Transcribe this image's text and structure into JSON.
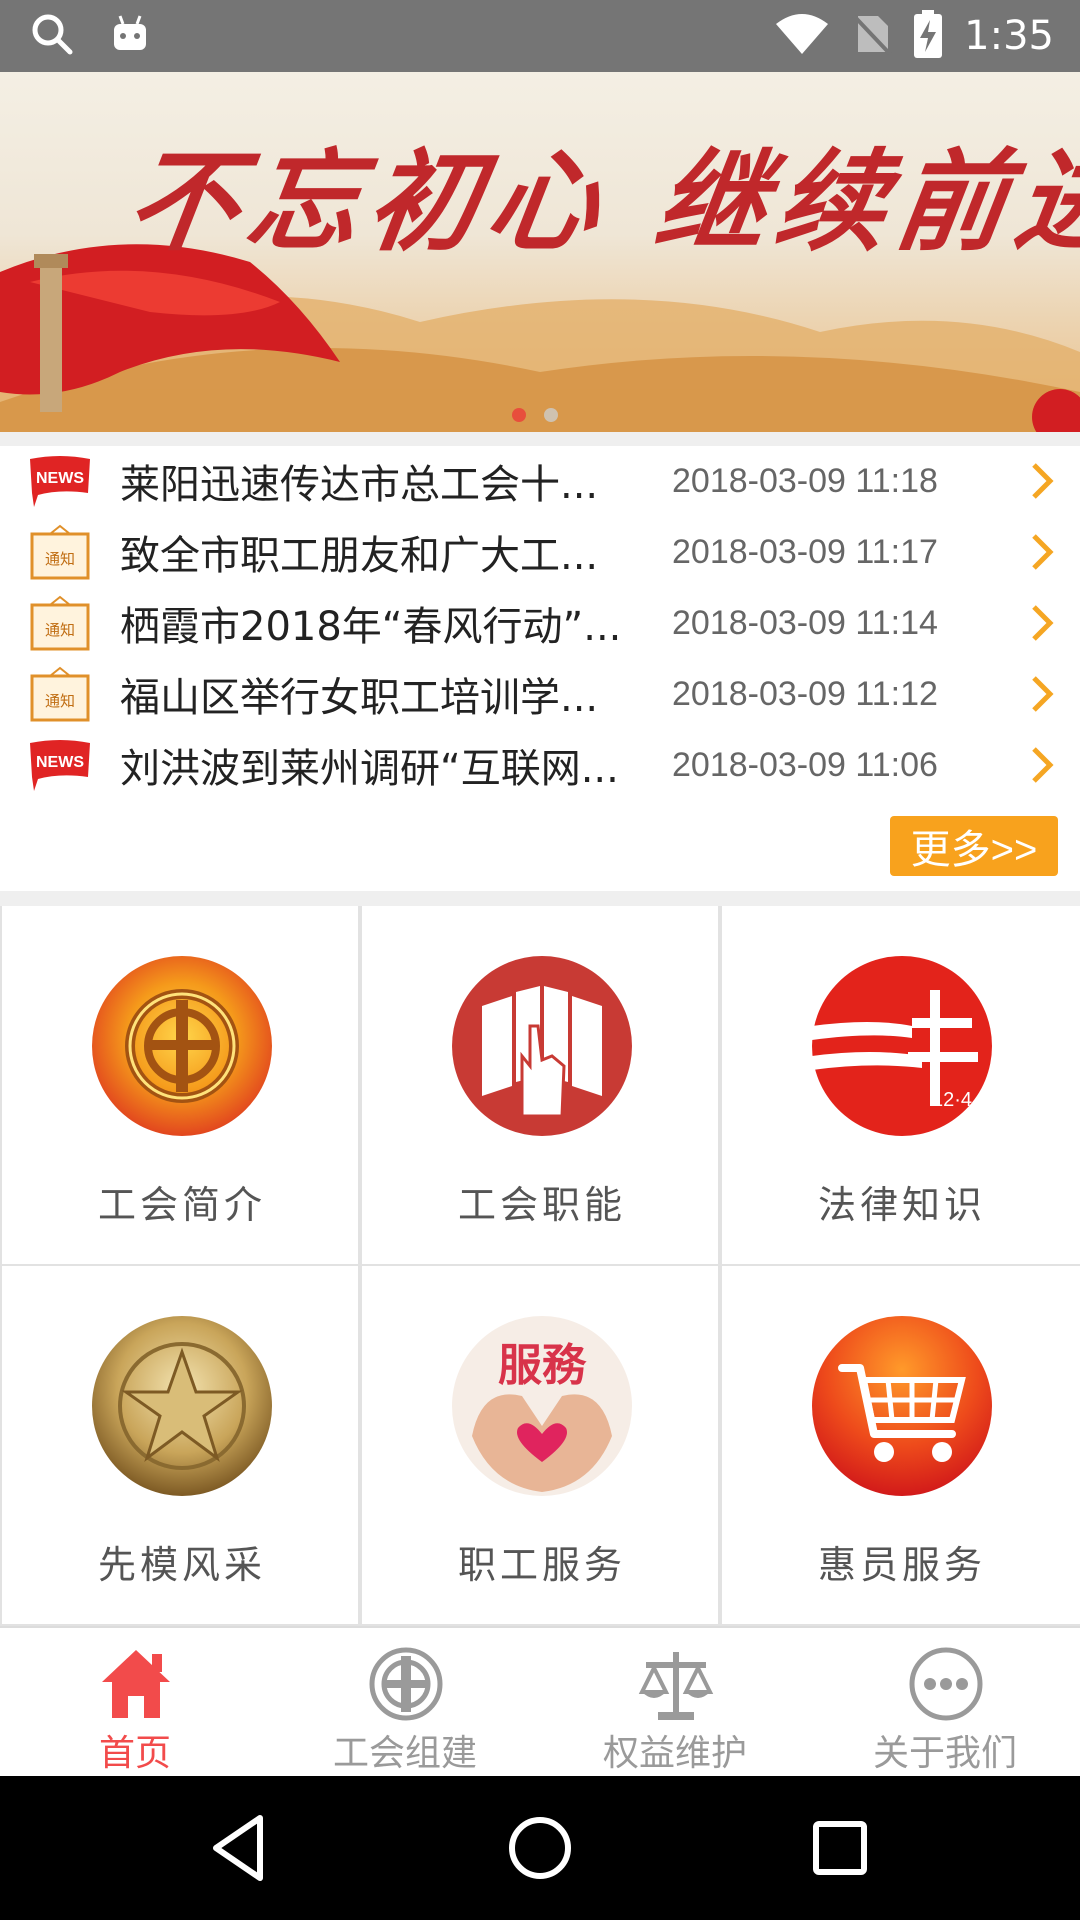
{
  "status_bar": {
    "time": "1:35",
    "icons": [
      "search-icon",
      "android-icon",
      "wifi-icon",
      "no-sim-icon",
      "battery-charging-icon"
    ]
  },
  "banner": {
    "title": "不忘初心 继续前进",
    "slide_count": 2,
    "active_slide": 0
  },
  "news": {
    "items": [
      {
        "badge": "NEWS",
        "title": "莱阳迅速传达市总工会十...",
        "date": "2018-03-09 11:18"
      },
      {
        "badge": "通知",
        "title": "致全市职工朋友和广大工...",
        "date": "2018-03-09 11:17"
      },
      {
        "badge": "通知",
        "title": "栖霞市2018年“春风行动”...",
        "date": "2018-03-09 11:14"
      },
      {
        "badge": "通知",
        "title": "福山区举行女职工培训学...",
        "date": "2018-03-09 11:12"
      },
      {
        "badge": "NEWS",
        "title": "刘洪波到莱州调研“互联网...",
        "date": "2018-03-09 11:06"
      }
    ],
    "more_label": "更多>>"
  },
  "grid": {
    "items": [
      {
        "label": "工会简介",
        "icon": "union-emblem-icon"
      },
      {
        "label": "工会职能",
        "icon": "books-hand-icon"
      },
      {
        "label": "法律知识",
        "icon": "law-logo-icon"
      },
      {
        "label": "先模风采",
        "icon": "star-medal-icon"
      },
      {
        "label": "职工服务",
        "icon": "service-heart-icon"
      },
      {
        "label": "惠员服务",
        "icon": "shopping-cart-icon"
      }
    ],
    "cart_numbers": "12·4"
  },
  "tabbar": {
    "tabs": [
      {
        "label": "首页",
        "icon": "home-icon",
        "active": true
      },
      {
        "label": "工会组建",
        "icon": "union-emblem-icon",
        "active": false
      },
      {
        "label": "权益维护",
        "icon": "scales-icon",
        "active": false
      },
      {
        "label": "关于我们",
        "icon": "more-dots-icon",
        "active": false
      }
    ]
  },
  "colors": {
    "accent_red": "#f24b4b",
    "more_orange": "#f8a21d",
    "arrow_orange": "#f5a623",
    "status_bar": "#757575"
  }
}
